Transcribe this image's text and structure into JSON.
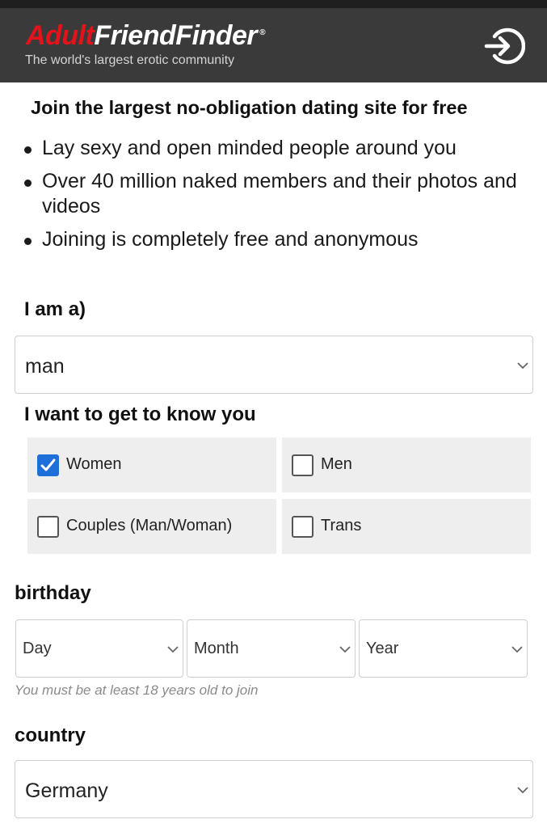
{
  "header": {
    "logo_part1": "Adult",
    "logo_part2": "FriendFinder",
    "logo_reg": "®",
    "tagline": "The world's largest erotic community",
    "login_icon": "sign-in-icon",
    "colors": {
      "bar": "#3a3a3a",
      "logo_red": "#e3131b",
      "logo_white": "#ffffff"
    }
  },
  "intro": {
    "headline": "Join the largest no-obligation dating site for free",
    "benefits": [
      "Lay sexy and open minded people around you",
      "Over 40 million naked members and their photos and videos",
      "Joining is completely free and anonymous"
    ]
  },
  "form": {
    "gender": {
      "label": "I am a)",
      "value": "man"
    },
    "seeking": {
      "label": "I want to get to know you",
      "options": [
        {
          "label": "Women",
          "checked": true
        },
        {
          "label": "Men",
          "checked": false
        },
        {
          "label": "Couples (Man/Woman)",
          "checked": false
        },
        {
          "label": "Trans",
          "checked": false
        }
      ]
    },
    "birthday": {
      "label": "birthday",
      "day_placeholder": "Day",
      "month_placeholder": "Month",
      "year_placeholder": "Year",
      "hint": "You must be at least 18 years old to join"
    },
    "country": {
      "label": "country",
      "value": "Germany"
    }
  },
  "colors": {
    "accent": "#1e6fd9",
    "checkbox_bg": "#eeeeee"
  }
}
